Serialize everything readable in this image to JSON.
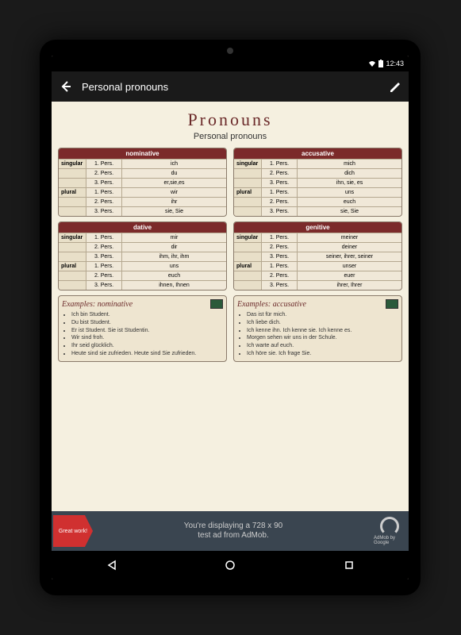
{
  "statusbar": {
    "time": "12:43"
  },
  "appbar": {
    "title": "Personal pronouns"
  },
  "page": {
    "title": "Pronouns",
    "subtitle": "Personal pronouns"
  },
  "tables": {
    "nominative": {
      "header": "nominative",
      "rows": [
        [
          "singular",
          "1. Pers.",
          "ich"
        ],
        [
          "",
          "2. Pers.",
          "du"
        ],
        [
          "",
          "3. Pers.",
          "er,sie,es"
        ],
        [
          "plural",
          "1. Pers.",
          "wir"
        ],
        [
          "",
          "2. Pers.",
          "ihr"
        ],
        [
          "",
          "3. Pers.",
          "sie, Sie"
        ]
      ]
    },
    "accusative": {
      "header": "accusative",
      "rows": [
        [
          "singular",
          "1. Pers.",
          "mich"
        ],
        [
          "",
          "2. Pers.",
          "dich"
        ],
        [
          "",
          "3. Pers.",
          "ihn, sie, es"
        ],
        [
          "plural",
          "1. Pers.",
          "uns"
        ],
        [
          "",
          "2. Pers.",
          "euch"
        ],
        [
          "",
          "3. Pers.",
          "sie, Sie"
        ]
      ]
    },
    "dative": {
      "header": "dative",
      "rows": [
        [
          "singular",
          "1. Pers.",
          "mir"
        ],
        [
          "",
          "2. Pers.",
          "dir"
        ],
        [
          "",
          "3. Pers.",
          "ihm, ihr, ihm"
        ],
        [
          "plural",
          "1. Pers.",
          "uns"
        ],
        [
          "",
          "2. Pers.",
          "euch"
        ],
        [
          "",
          "3. Pers.",
          "ihnen, Ihnen"
        ]
      ]
    },
    "genitive": {
      "header": "genitive",
      "rows": [
        [
          "singular",
          "1. Pers.",
          "meiner"
        ],
        [
          "",
          "2. Pers.",
          "deiner"
        ],
        [
          "",
          "3. Pers.",
          "seiner, ihrer, seiner"
        ],
        [
          "plural",
          "1. Pers.",
          "unser"
        ],
        [
          "",
          "2. Pers.",
          "euer"
        ],
        [
          "",
          "3. Pers.",
          "ihrer, Ihrer"
        ]
      ]
    }
  },
  "examples": {
    "nominative": {
      "title": "Examples: nominative",
      "items": [
        "Ich bin Student.",
        "Du bist Student.",
        "Er ist Student. Sie ist Studentin.",
        "Wir sind froh.",
        "Ihr seid glücklich.",
        "Heute sind sie zufrieden. Heute sind Sie zufrieden."
      ]
    },
    "accusative": {
      "title": "Examples: accusative",
      "items": [
        "Das ist für mich.",
        "Ich liebe dich.",
        "Ich kenne ihn. Ich kenne sie. Ich kenne es.",
        "Morgen sehen wir uns in der Schule.",
        "Ich warte auf euch.",
        "Ich höre sie. Ich frage Sie."
      ]
    }
  },
  "ad": {
    "badge": "Great work!",
    "text1": "You're displaying a 728 x 90",
    "text2": "test ad from AdMob.",
    "brand": "AdMob by Google"
  }
}
